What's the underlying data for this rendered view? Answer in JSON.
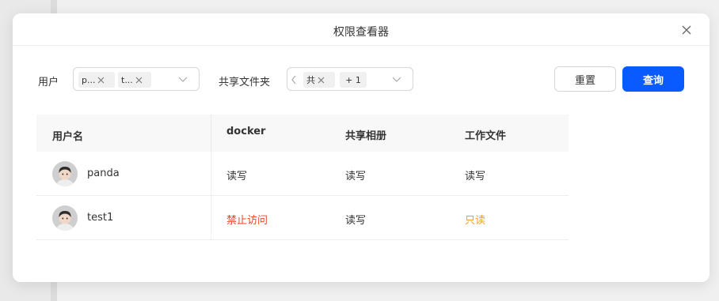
{
  "dialog": {
    "title": "权限查看器",
    "close_icon": "close-icon"
  },
  "filters": {
    "user": {
      "label": "用户",
      "tags": [
        "p...",
        "t..."
      ]
    },
    "folder": {
      "label": "共享文件夹",
      "tags": [
        "共",
        "+ 1"
      ]
    }
  },
  "buttons": {
    "reset": "重置",
    "query": "查询"
  },
  "colors": {
    "primary": "#0a5bff",
    "denied": "#e8452c",
    "readonly": "#f0a020"
  },
  "table": {
    "columns": [
      "用户名",
      "docker",
      "共享相册",
      "工作文件"
    ],
    "rows": [
      {
        "user": "panda",
        "cells": [
          "读写",
          "读写",
          "读写"
        ]
      },
      {
        "user": "test1",
        "cells": [
          "禁止访问",
          "读写",
          "只读"
        ]
      }
    ]
  }
}
